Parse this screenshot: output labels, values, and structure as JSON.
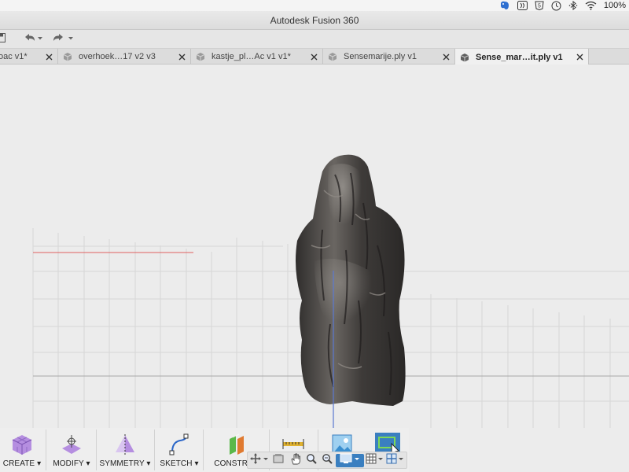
{
  "menubar": {
    "battery_text": "100%",
    "icons": [
      "evernote-icon",
      "reader-icon",
      "html5-icon",
      "time-machine-icon",
      "bluetooth-icon",
      "wifi-icon"
    ]
  },
  "window": {
    "title": "Autodesk Fusion 360"
  },
  "quick_access": {
    "buttons": [
      "save-icon",
      "undo-icon",
      "redo-icon"
    ]
  },
  "tabs": [
    {
      "label": "oac v1*",
      "active": false
    },
    {
      "label": "overhoek…17 v2 v3",
      "active": false
    },
    {
      "label": "kastje_pl…Ac v1 v1*",
      "active": false
    },
    {
      "label": "Sensemarije.ply v1",
      "active": false
    },
    {
      "label": "Sense_mar…it.ply v1",
      "active": true
    }
  ],
  "toolbar": {
    "tools": [
      {
        "label": "CREATE",
        "icon": "create-box-icon"
      },
      {
        "label": "MODIFY",
        "icon": "modify-icon"
      },
      {
        "label": "SYMMETRY",
        "icon": "symmetry-icon"
      },
      {
        "label": "SKETCH",
        "icon": "sketch-icon"
      },
      {
        "label": "CONSTRUC",
        "icon": "construct-icon"
      },
      {
        "label": "",
        "icon": "inspect-icon"
      },
      {
        "label": "",
        "icon": "insert-image-icon"
      },
      {
        "label": "",
        "icon": "select-icon"
      }
    ]
  },
  "navbar": {
    "buttons": [
      "orbit-icon",
      "look-at-icon",
      "pan-icon",
      "zoom-icon",
      "zoom-window-icon",
      "display-mode-icon",
      "grid-icon",
      "viewports-icon"
    ]
  },
  "colors": {
    "canvas_bg": "#ececec",
    "grid_line": "#d4d4d4",
    "axis_x": "#e06060",
    "axis_y": "#5a78d0",
    "model": "#4a4745",
    "active_tab_bg": "#f0f0f0"
  }
}
